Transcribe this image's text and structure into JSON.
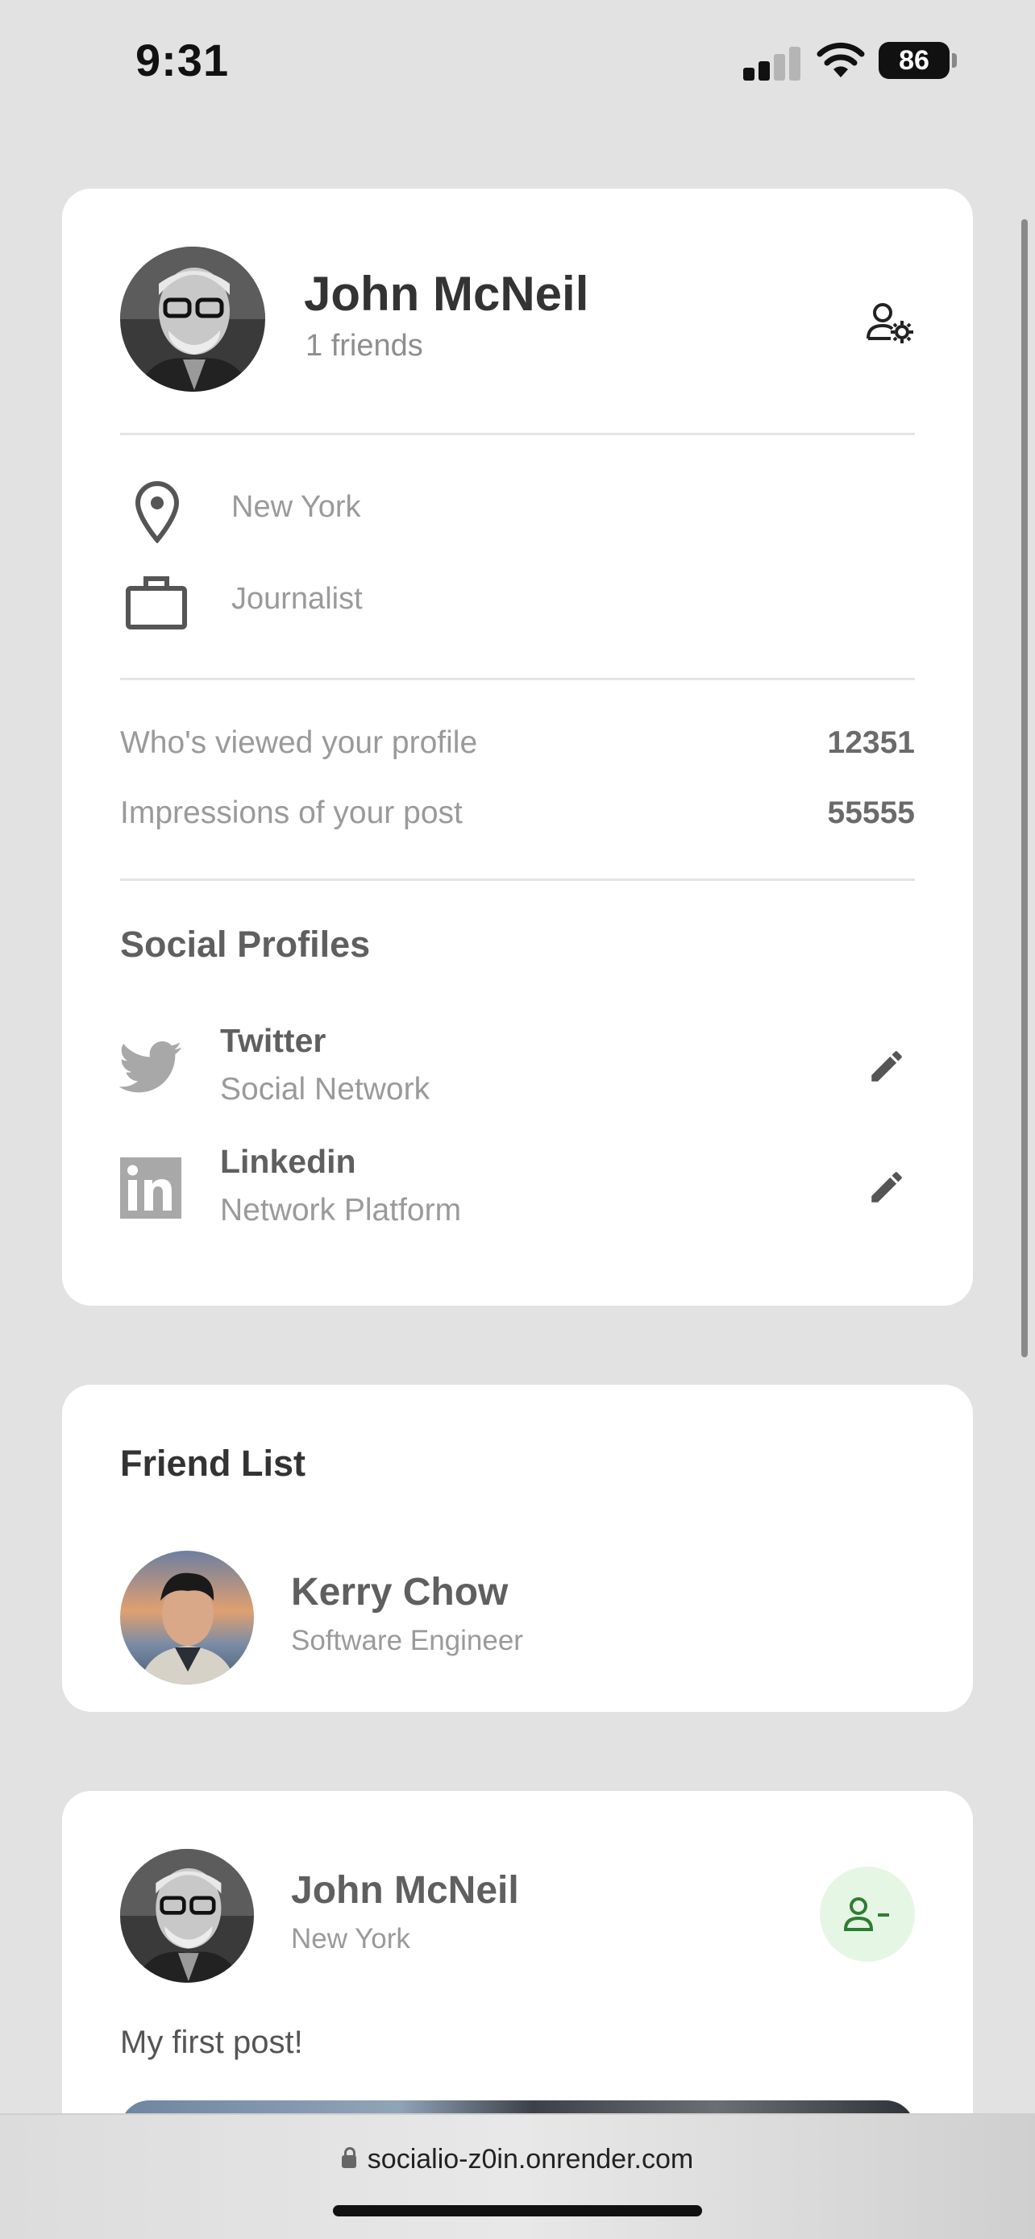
{
  "status_bar": {
    "time": "9:31",
    "battery": "86"
  },
  "profile": {
    "name": "John McNeil",
    "friends": "1 friends",
    "location": "New York",
    "occupation": "Journalist",
    "stats": [
      {
        "label": "Who's viewed your profile",
        "value": "12351"
      },
      {
        "label": "Impressions of your post",
        "value": "55555"
      }
    ],
    "social_title": "Social Profiles",
    "socials": [
      {
        "name": "Twitter",
        "type": "Social Network",
        "icon": "twitter-icon"
      },
      {
        "name": "Linkedin",
        "type": "Network Platform",
        "icon": "linkedin-icon"
      }
    ]
  },
  "friend_list": {
    "title": "Friend List",
    "friends": [
      {
        "name": "Kerry Chow",
        "job": "Software Engineer"
      }
    ]
  },
  "post": {
    "author": "John McNeil",
    "location": "New York",
    "text": "My first post!"
  },
  "browser": {
    "url": "socialio-z0in.onrender.com"
  },
  "colors": {
    "background": "#e2e2e2",
    "card": "#ffffff",
    "accent_green": "#2e7d32",
    "unfriend_bg": "#e6f6e4"
  }
}
